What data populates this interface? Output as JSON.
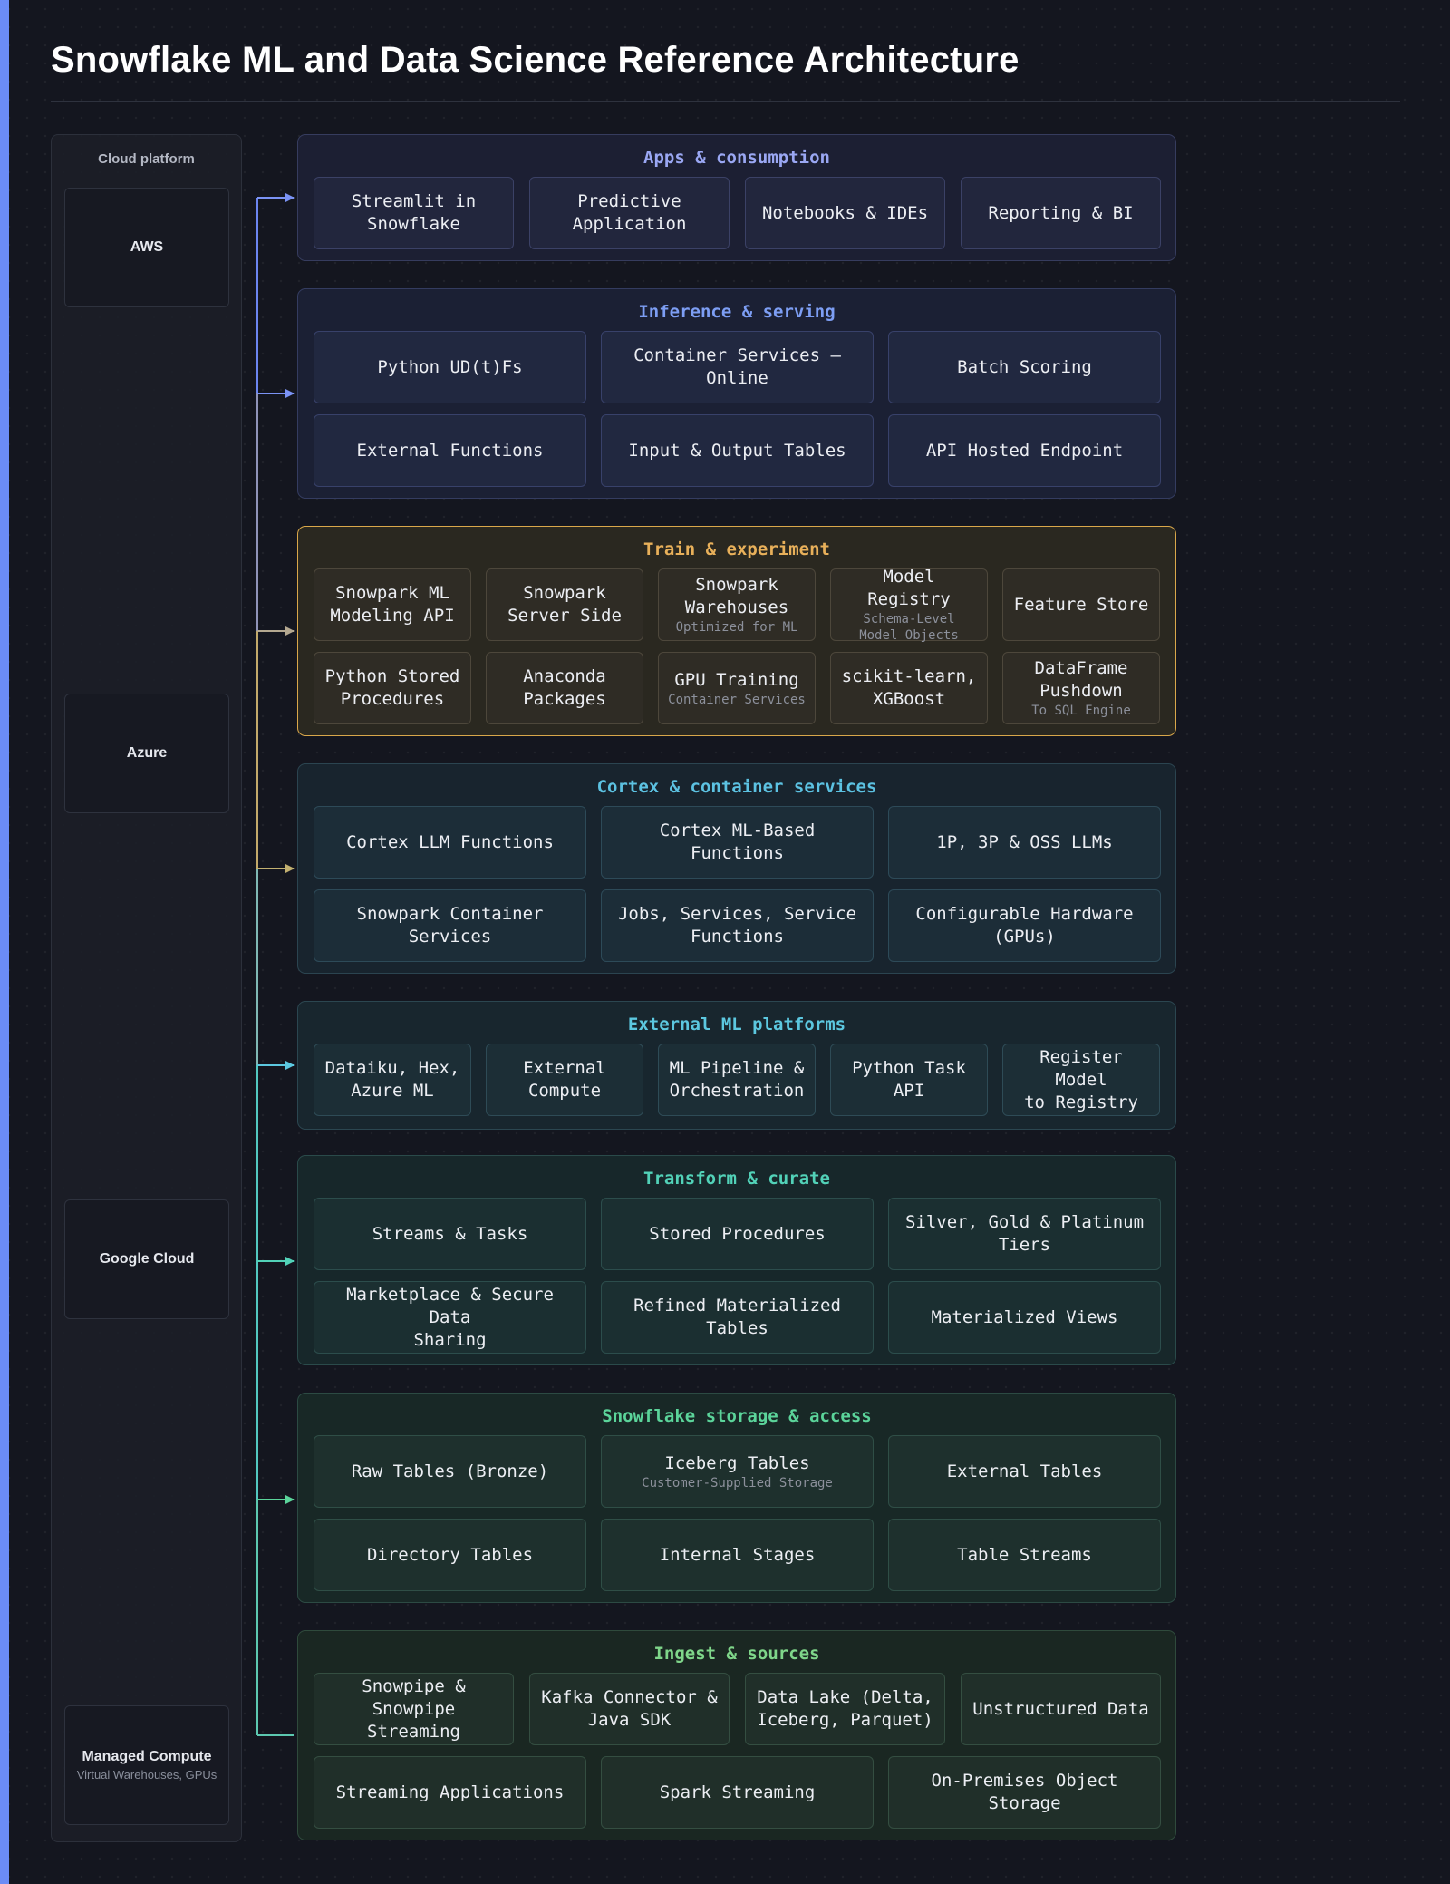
{
  "title": "Snowflake ML and Data Science Reference Architecture",
  "platform": {
    "header": "Cloud platform",
    "providers": [
      {
        "name": "AWS",
        "sub": ""
      },
      {
        "name": "Azure",
        "sub": ""
      },
      {
        "name": "Google Cloud",
        "sub": ""
      },
      {
        "name": "Managed Compute",
        "sub": "Virtual Warehouses, GPUs"
      }
    ]
  },
  "colors": {
    "accent": "#6b8cf6",
    "apps": "#9aa7f3",
    "inference": "#7d9ef4",
    "train": "#e8b05a",
    "cortex": "#5cc2e2",
    "external": "#5cc8e0",
    "transform": "#52d2b8",
    "storage": "#5bd49a",
    "ingest": "#7fd68a"
  },
  "layers": {
    "apps": {
      "title": "Apps & consumption",
      "tiles": [
        {
          "label": "Streamlit in\nSnowflake"
        },
        {
          "label": "Predictive\nApplication"
        },
        {
          "label": "Notebooks & IDEs"
        },
        {
          "label": "Reporting & BI"
        }
      ]
    },
    "inference": {
      "title": "Inference & serving",
      "tiles": [
        {
          "label": "Python UD(t)Fs"
        },
        {
          "label": "Container Services — Online"
        },
        {
          "label": "Batch Scoring"
        },
        {
          "label": "External Functions"
        },
        {
          "label": "Input & Output Tables"
        },
        {
          "label": "API Hosted Endpoint"
        }
      ]
    },
    "train": {
      "title": "Train & experiment",
      "tiles": [
        {
          "label": "Snowpark ML\nModeling API",
          "sub": ""
        },
        {
          "label": "Snowpark\nServer Side",
          "sub": ""
        },
        {
          "label": "Snowpark\nWarehouses",
          "sub": "Optimized for ML"
        },
        {
          "label": "Model Registry",
          "sub": "Schema-Level\nModel Objects"
        },
        {
          "label": "Feature Store",
          "sub": ""
        },
        {
          "label": "Python Stored\nProcedures",
          "sub": ""
        },
        {
          "label": "Anaconda\nPackages",
          "sub": ""
        },
        {
          "label": "GPU Training",
          "sub": "Container Services"
        },
        {
          "label": "scikit-learn,\nXGBoost",
          "sub": ""
        },
        {
          "label": "DataFrame\nPushdown",
          "sub": "To SQL Engine"
        }
      ]
    },
    "cortex": {
      "title": "Cortex & container services",
      "tiles": [
        {
          "label": "Cortex LLM Functions"
        },
        {
          "label": "Cortex ML-Based Functions"
        },
        {
          "label": "1P, 3P & OSS LLMs"
        },
        {
          "label": "Snowpark Container Services"
        },
        {
          "label": "Jobs, Services, Service\nFunctions"
        },
        {
          "label": "Configurable Hardware\n(GPUs)"
        }
      ]
    },
    "external": {
      "title": "External ML platforms",
      "tiles": [
        {
          "label": "Dataiku, Hex,\nAzure ML"
        },
        {
          "label": "External\nCompute"
        },
        {
          "label": "ML Pipeline &\nOrchestration"
        },
        {
          "label": "Python Task\nAPI"
        },
        {
          "label": "Register Model\nto Registry"
        }
      ]
    },
    "transform": {
      "title": "Transform & curate",
      "tiles": [
        {
          "label": "Streams & Tasks"
        },
        {
          "label": "Stored Procedures"
        },
        {
          "label": "Silver, Gold & Platinum Tiers"
        },
        {
          "label": "Marketplace & Secure Data\nSharing"
        },
        {
          "label": "Refined Materialized Tables"
        },
        {
          "label": "Materialized Views"
        }
      ]
    },
    "storage": {
      "title": "Snowflake storage & access",
      "tiles": [
        {
          "label": "Raw Tables (Bronze)",
          "sub": ""
        },
        {
          "label": "Iceberg Tables",
          "sub": "Customer-Supplied Storage"
        },
        {
          "label": "External Tables",
          "sub": ""
        },
        {
          "label": "Directory Tables",
          "sub": ""
        },
        {
          "label": "Internal Stages",
          "sub": ""
        },
        {
          "label": "Table Streams",
          "sub": ""
        }
      ]
    },
    "ingest": {
      "title": "Ingest & sources",
      "tiles": [
        {
          "label": "Snowpipe &\nSnowpipe Streaming"
        },
        {
          "label": "Kafka Connector &\nJava SDK"
        },
        {
          "label": "Data Lake (Delta,\nIceberg, Parquet)"
        },
        {
          "label": "Unstructured Data"
        },
        {
          "label": "Streaming Applications"
        },
        {
          "label": "Spark Streaming"
        },
        {
          "label": "On-Premises Object Storage"
        }
      ]
    }
  }
}
